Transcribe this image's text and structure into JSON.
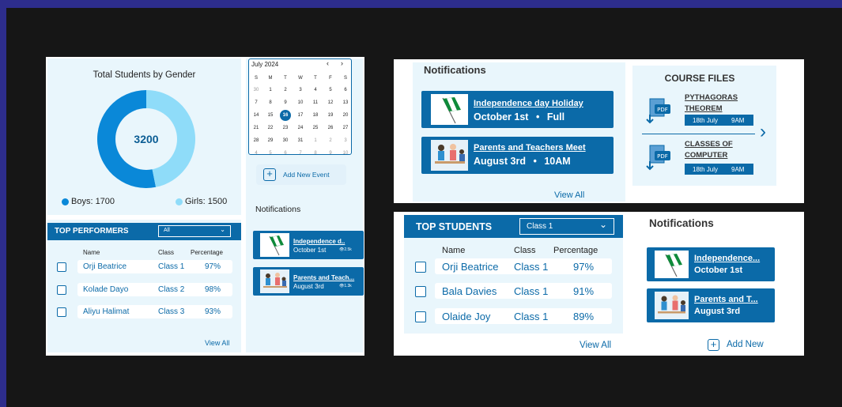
{
  "colors": {
    "primary": "#0b6aa8",
    "boys": "#0a88d8",
    "girls": "#8fdcf9",
    "background": "#161616",
    "frame": "#2d2d8c"
  },
  "gender_panel": {
    "title": "Total Students by Gender",
    "total": "3200",
    "boys_label": "Boys: 1700",
    "girls_label": "Girls: 1500",
    "chart_data": {
      "type": "pie",
      "categories": [
        "Boys",
        "Girls"
      ],
      "values": [
        1700,
        1500
      ]
    }
  },
  "calendar": {
    "month": "July 2024",
    "weekdays": [
      "S",
      "M",
      "T",
      "W",
      "T",
      "F",
      "S"
    ],
    "weeks": [
      [
        "30",
        "1",
        "2",
        "3",
        "4",
        "5",
        "6"
      ],
      [
        "7",
        "8",
        "9",
        "10",
        "11",
        "12",
        "13"
      ],
      [
        "14",
        "15",
        "16",
        "17",
        "18",
        "19",
        "20"
      ],
      [
        "21",
        "22",
        "23",
        "24",
        "25",
        "26",
        "27"
      ],
      [
        "28",
        "29",
        "30",
        "31",
        "1",
        "2",
        "3"
      ],
      [
        "4",
        "5",
        "6",
        "7",
        "8",
        "9",
        "10"
      ]
    ],
    "selected": "16",
    "prev_icon": "chevron-left-icon",
    "next_icon": "chevron-right-icon"
  },
  "add_event": {
    "label": "Add New Event",
    "icon": "plus-icon"
  },
  "left_notifications": {
    "title": "Notifications",
    "items": [
      {
        "title": "Independence d..",
        "date": "October 1st",
        "views": "2.5k",
        "icon": "flag-icon"
      },
      {
        "title": "Parents and Teach...",
        "date": "August 3rd",
        "views": "1.3k",
        "icon": "meeting-icon"
      }
    ]
  },
  "top_performers": {
    "title": "TOP PERFORMERS",
    "filter": "All",
    "columns": [
      "Name",
      "Class",
      "Percentage"
    ],
    "rows": [
      {
        "name": "Orji Beatrice",
        "class": "Class 1",
        "percentage": "97%"
      },
      {
        "name": "Kolade Dayo",
        "class": "Class 2",
        "percentage": "98%"
      },
      {
        "name": "Aliyu Halimat",
        "class": "Class 3",
        "percentage": "93%"
      }
    ],
    "view_all": "View All"
  },
  "right_top": {
    "notifications_title": "Notifications",
    "items": [
      {
        "title": "Independence day Holiday",
        "date": "October 1st",
        "sep": "•",
        "extra": "Full"
      },
      {
        "title": "Parents and Teachers Meet",
        "date": "August 3rd",
        "sep": "•",
        "extra": "10AM"
      }
    ],
    "view_all": "View All",
    "course_files": {
      "title": "COURSE FILES",
      "files": [
        {
          "name1": "PYTHAGORAS",
          "name2": "THEOREM",
          "date": "18th July",
          "time": "9AM",
          "icon": "pdf-download-icon"
        },
        {
          "name1": "CLASSES OF",
          "name2": "COMPUTER",
          "date": "18th July",
          "time": "9AM",
          "icon": "pdf-download-icon"
        }
      ],
      "next_icon": "chevron-right-icon"
    }
  },
  "right_bottom": {
    "title": "TOP STUDENTS",
    "filter": "Class 1",
    "columns": [
      "Name",
      "Class",
      "Percentage"
    ],
    "rows": [
      {
        "name": "Orji Beatrice",
        "class": "Class 1",
        "percentage": "97%"
      },
      {
        "name": "Bala Davies",
        "class": "Class 1",
        "percentage": "91%"
      },
      {
        "name": "Olaide Joy",
        "class": "Class 1",
        "percentage": "89%"
      }
    ],
    "view_all": "View All",
    "notifications_title": "Notifications",
    "items": [
      {
        "title": "Independence...",
        "date": "October 1st"
      },
      {
        "title": "Parents and T...",
        "date": "August 3rd"
      }
    ],
    "add_new": "Add New"
  }
}
